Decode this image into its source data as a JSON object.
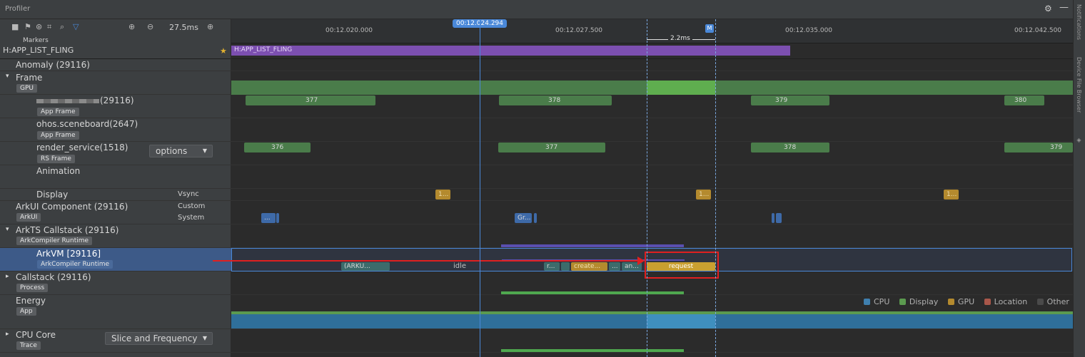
{
  "window": {
    "title": "Profiler"
  },
  "toolbar": {
    "zoom_label": "27.5ms"
  },
  "ruler": {
    "cursor_time": "00:12.024.294",
    "ticks": [
      "00:12.020.000",
      "00:12.027.500",
      "00:12.035.000",
      "00:12.042.500"
    ],
    "range_label": "2.2ms",
    "range_marker": "M"
  },
  "markers": {
    "header": "Markers",
    "name": "H:APP_LIST_FLING",
    "bar_label": "H:APP_LIST_FLING"
  },
  "rows": {
    "anomaly": "Anomaly (29116)",
    "frame": {
      "label": "Frame",
      "tag": "GPU"
    },
    "app": {
      "label": "(29116)",
      "tag": "App Frame",
      "frames": [
        "377",
        "378",
        "379",
        "380"
      ]
    },
    "sceneboard": {
      "label": "ohos.sceneboard(2647)",
      "tag": "App Frame"
    },
    "render": {
      "label": "render_service(1518)",
      "tag": "RS Frame",
      "select": "options",
      "frames": [
        "376",
        "377",
        "378",
        "379"
      ]
    },
    "animation": {
      "label": "Animation"
    },
    "display": {
      "label": "Display",
      "sub": "Vsync",
      "marks": [
        "1...",
        "1...",
        "1..."
      ]
    },
    "arkui": {
      "label": "ArkUI Component (29116)",
      "tag": "ArkUI",
      "sub1": "Custom",
      "sub2": "System",
      "marks": [
        "...",
        "Gr..."
      ]
    },
    "arkts": {
      "label": "ArkTS Callstack (29116)",
      "tag": "ArkCompiler Runtime"
    },
    "arkvm": {
      "label": "ArkVM [29116]",
      "tag": "ArkCompiler Runtime",
      "slices": [
        "(ARKU...",
        "idle",
        "r...",
        "create...",
        "...",
        "an...",
        "request"
      ]
    },
    "callstack": {
      "label": "Callstack (29116)",
      "tag": "Process"
    },
    "energy": {
      "label": "Energy",
      "tag": "App"
    },
    "cpu": {
      "label": "CPU Core",
      "tag": "Trace",
      "select": "Slice and Frequency"
    }
  },
  "legend": [
    {
      "label": "CPU",
      "color": "#3f7fae"
    },
    {
      "label": "Display",
      "color": "#5b9a4f"
    },
    {
      "label": "GPU",
      "color": "#b48a2e"
    },
    {
      "label": "Location",
      "color": "#a8574a"
    },
    {
      "label": "Other",
      "color": "#4a4a4a"
    }
  ],
  "sidebar_right": {
    "notifications": "Notifications",
    "device_file_browser": "Device File Browser"
  },
  "colors": {
    "accent_blue": "#4a88d8",
    "highlight_red": "#e02020",
    "selected_row": "#3d5a88"
  }
}
